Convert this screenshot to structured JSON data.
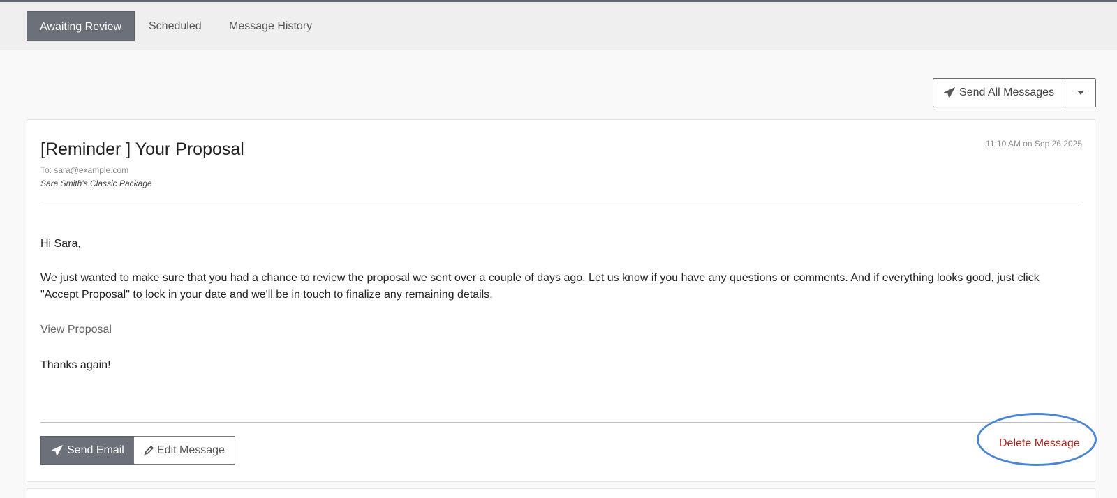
{
  "tabs": [
    {
      "label": "Awaiting Review",
      "active": true
    },
    {
      "label": "Scheduled",
      "active": false
    },
    {
      "label": "Message History",
      "active": false
    }
  ],
  "toolbar": {
    "send_all_label": "Send All Messages",
    "send_all_icon": "paper-plane-icon",
    "dropdown_icon": "caret-down-icon"
  },
  "message": {
    "subject": "[Reminder ] Your Proposal",
    "date": "11:10 AM on Sep 26 2025",
    "to": "To: sara@example.com",
    "package": "Sara Smith's Classic Package",
    "greeting": "Hi Sara,",
    "paragraph": "We just wanted to make sure that you had a chance to review the proposal we sent over a couple of days ago. Let us know if you have any questions or comments. And if everything looks good, just click \"Accept Proposal\" to lock in your date and we'll be in touch to finalize any remaining details.",
    "link": "View Proposal",
    "closing": "Thanks again!"
  },
  "actions": {
    "send_label": "Send Email",
    "send_icon": "paper-plane-icon",
    "edit_label": "Edit Message",
    "edit_icon": "pencil-icon",
    "delete_label": "Delete Message"
  },
  "colors": {
    "active_tab_bg": "#6c7078",
    "delete_text": "#a8241e",
    "highlight_circle": "#4a86d4"
  }
}
